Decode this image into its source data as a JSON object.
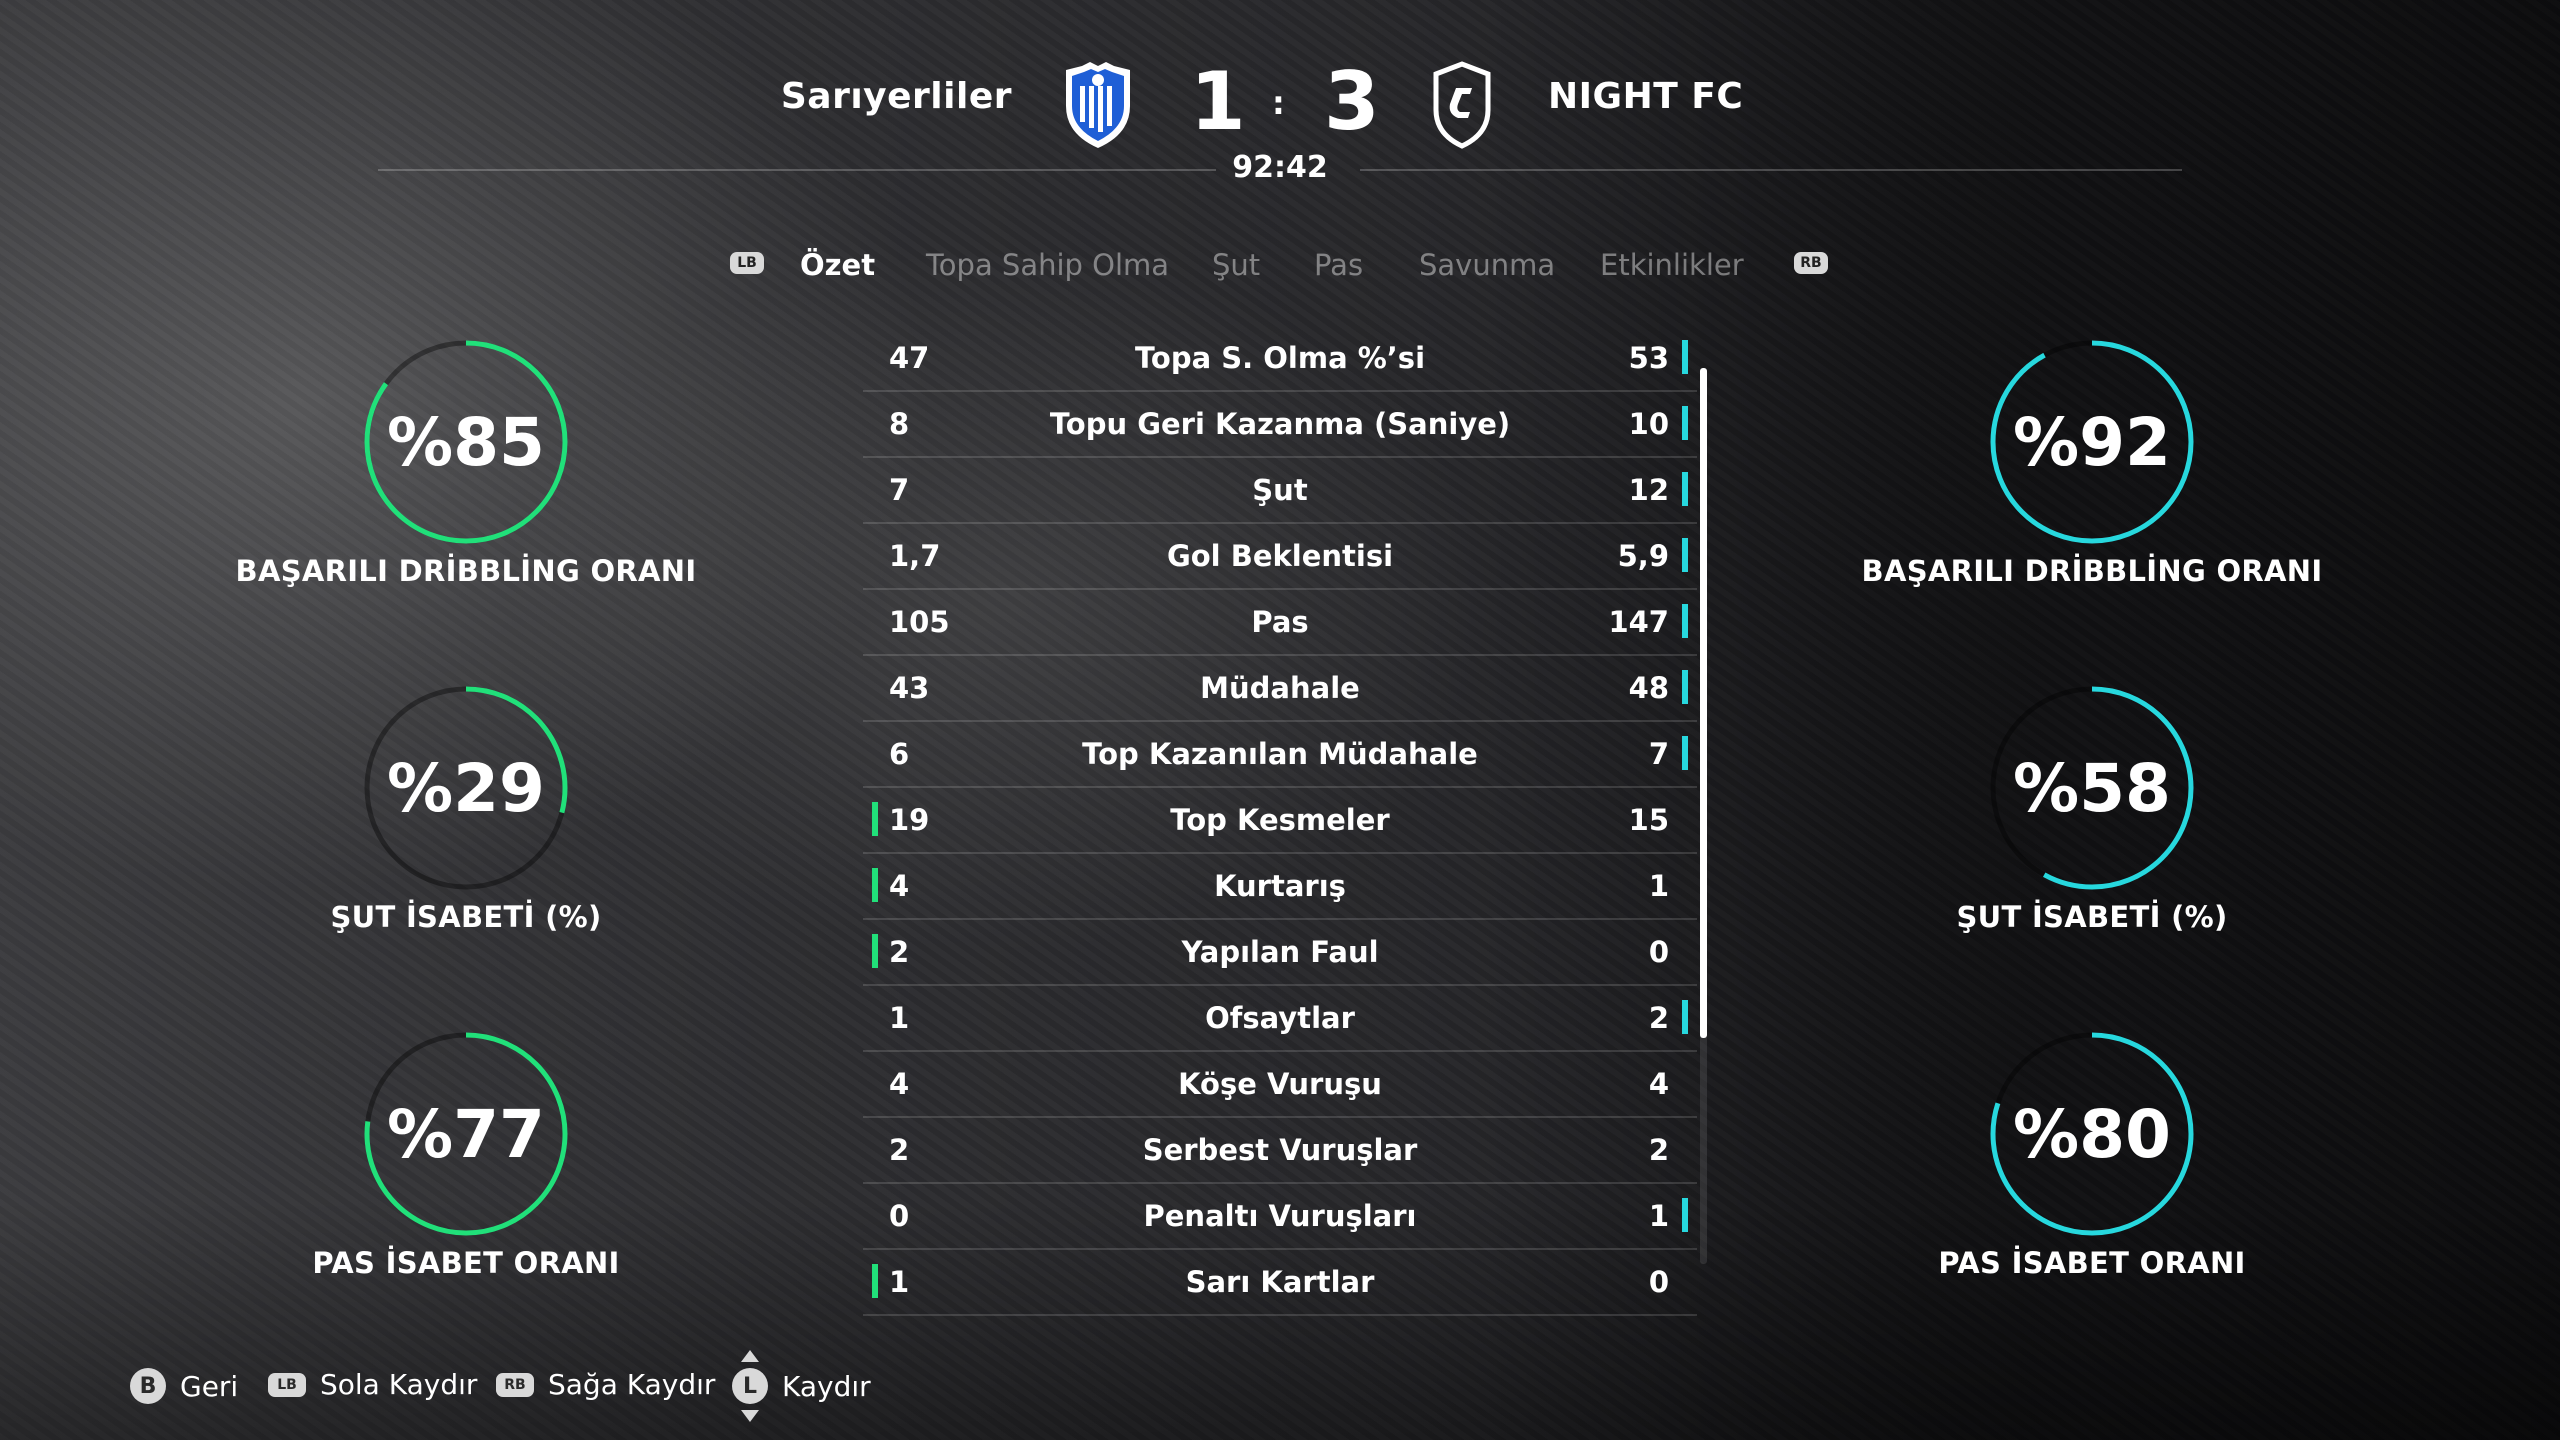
{
  "match": {
    "home_team": "Sarıyerliler",
    "away_team": "NIGHT FC",
    "home_score": "1",
    "separator": ":",
    "away_score": "3",
    "clock": "92:42"
  },
  "colors": {
    "home_accent": "#21e07a",
    "away_accent": "#27d8de",
    "home_crest_blue": "#1f5fd6"
  },
  "tabs": {
    "left_bumper": "LB",
    "right_bumper": "RB",
    "items": [
      "Özet",
      "Topa Sahip Olma",
      "Şut",
      "Pas",
      "Savunma",
      "Etkinlikler"
    ],
    "active_index": 0
  },
  "stats": [
    {
      "home": "47",
      "label": "Topa S. Olma %’si",
      "away": "53",
      "leader": "away"
    },
    {
      "home": "8",
      "label": "Topu Geri Kazanma (Saniye)",
      "away": "10",
      "leader": "away"
    },
    {
      "home": "7",
      "label": "Şut",
      "away": "12",
      "leader": "away"
    },
    {
      "home": "1,7",
      "label": "Gol Beklentisi",
      "away": "5,9",
      "leader": "away"
    },
    {
      "home": "105",
      "label": "Pas",
      "away": "147",
      "leader": "away"
    },
    {
      "home": "43",
      "label": "Müdahale",
      "away": "48",
      "leader": "away"
    },
    {
      "home": "6",
      "label": "Top Kazanılan Müdahale",
      "away": "7",
      "leader": "away"
    },
    {
      "home": "19",
      "label": "Top Kesmeler",
      "away": "15",
      "leader": "home"
    },
    {
      "home": "4",
      "label": "Kurtarış",
      "away": "1",
      "leader": "home"
    },
    {
      "home": "2",
      "label": "Yapılan Faul",
      "away": "0",
      "leader": "home"
    },
    {
      "home": "1",
      "label": "Ofsaytlar",
      "away": "2",
      "leader": "away"
    },
    {
      "home": "4",
      "label": "Köşe Vuruşu",
      "away": "4",
      "leader": "none"
    },
    {
      "home": "2",
      "label": "Serbest Vuruşlar",
      "away": "2",
      "leader": "none"
    },
    {
      "home": "0",
      "label": "Penaltı Vuruşları",
      "away": "1",
      "leader": "away"
    },
    {
      "home": "1",
      "label": "Sarı Kartlar",
      "away": "0",
      "leader": "home"
    }
  ],
  "home_rings": [
    {
      "display": "%85",
      "value": 0.85,
      "label": "BAŞARILI DRİBBLİNG ORANI"
    },
    {
      "display": "%29",
      "value": 0.29,
      "label": "ŞUT İSABETİ (%)"
    },
    {
      "display": "%77",
      "value": 0.77,
      "label": "PAS İSABET ORANI"
    }
  ],
  "away_rings": [
    {
      "display": "%92",
      "value": 0.92,
      "label": "BAŞARILI DRİBBLİNG ORANI"
    },
    {
      "display": "%58",
      "value": 0.58,
      "label": "ŞUT İSABETİ (%)"
    },
    {
      "display": "%80",
      "value": 0.8,
      "label": "PAS İSABET ORANI"
    }
  ],
  "footer": {
    "back_button": "B",
    "back_label": "Geri",
    "left_bumper": "LB",
    "left_label": "Sola Kaydır",
    "right_bumper": "RB",
    "right_label": "Sağa Kaydır",
    "stick_button": "L",
    "stick_label": "Kaydır"
  }
}
